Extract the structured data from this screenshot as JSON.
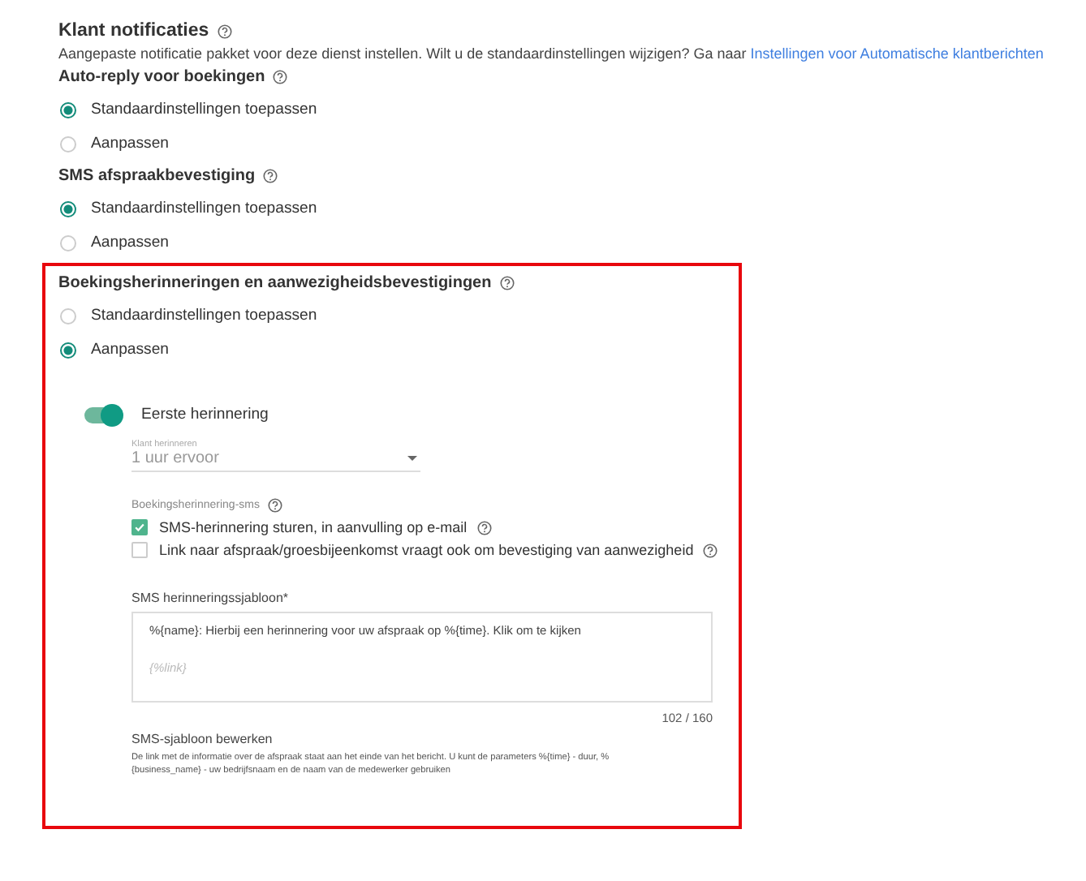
{
  "header": {
    "title": "Klant notificaties",
    "help": true,
    "description": "Aangepaste notificatie pakket voor deze dienst instellen. Wilt u de standaardinstellingen wijzigen? Ga naar ",
    "link": "Instellingen voor Automatische klantberichten"
  },
  "groups": [
    {
      "title": "Auto-reply voor boekingen",
      "help": true,
      "highlighted": false,
      "options": [
        {
          "label": "Standaardinstellingen toepassen",
          "selected": true
        },
        {
          "label": "Aanpassen",
          "selected": false
        }
      ]
    },
    {
      "title": "SMS afspraakbevestiging",
      "help": true,
      "highlighted": false,
      "options": [
        {
          "label": "Standaardinstellingen toepassen",
          "selected": true
        },
        {
          "label": "Aanpassen",
          "selected": false
        }
      ]
    },
    {
      "title": "Boekingsherinneringen en aanwezigheidsbevestigingen",
      "help": true,
      "highlighted": true,
      "options": [
        {
          "label": "Standaardinstellingen toepassen",
          "selected": false
        },
        {
          "label": "Aanpassen",
          "selected": true
        }
      ],
      "custom": {
        "toggle": {
          "label": "Eerste herinnering",
          "on": true
        },
        "select": {
          "label": "Klant herinneren",
          "value": "1 uur ervoor"
        },
        "sms": {
          "label": "Boekingsherinnering-sms",
          "help": true,
          "checkboxes": [
            {
              "label": "SMS-herinnering sturen, in aanvulling op e-mail",
              "checked": true,
              "help": true
            },
            {
              "label": "Link naar afspraak/groesbijeenkomst vraagt ook om bevestiging van aanwezigheid",
              "checked": false,
              "help": true
            }
          ]
        },
        "template": {
          "label": "SMS herinneringssjabloon*",
          "text": "%{name}: Hierbij een herinnering voor uw afspraak op %{time}. Klik om te kijken",
          "link": "{%link}",
          "counter": "102 / 160"
        },
        "edit": {
          "title": "SMS-sjabloon bewerken",
          "description": "De link met de informatie over de afspraak staat aan het einde van het bericht. U kunt de parameters %{time} - duur, %{business_name} - uw bedrijfsnaam en de naam van de medewerker gebruiken"
        }
      }
    }
  ]
}
